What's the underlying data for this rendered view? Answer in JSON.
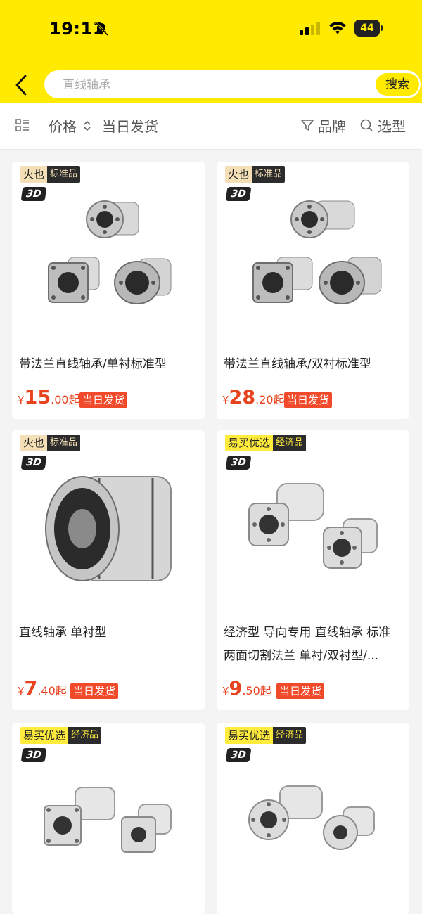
{
  "status_bar": {
    "time": "19:11",
    "battery": "44"
  },
  "search": {
    "placeholder": "直线轴承",
    "button": "搜索"
  },
  "filters": {
    "price": "价格",
    "same_day": "当日发货",
    "brand": "品牌",
    "select": "选型"
  },
  "products": [
    {
      "brand": "火也",
      "type": "标准品",
      "badge": "3D",
      "title": "带法兰直线轴承/单衬标准型",
      "price_big": "15",
      "price_small": ".00起",
      "currency": "¥",
      "ship": "当日发货"
    },
    {
      "brand": "火也",
      "type": "标准品",
      "badge": "3D",
      "title": "带法兰直线轴承/双衬标准型",
      "price_big": "28",
      "price_small": ".20起",
      "currency": "¥",
      "ship": "当日发货"
    },
    {
      "brand": "火也",
      "type": "标准品",
      "badge": "3D",
      "title": "直线轴承 单衬型",
      "price_big": "7",
      "price_small": ".40起",
      "currency": "¥",
      "ship": "当日发货"
    },
    {
      "brand": "易买优选",
      "type": "经济品",
      "badge": "3D",
      "title": "经济型 导向专用 直线轴承 标准两面切割法兰 单衬/双衬型/...",
      "price_big": "9",
      "price_small": ".50起",
      "currency": "¥",
      "ship": "当日发货"
    },
    {
      "brand": "易买优选",
      "type": "经济品",
      "badge": "3D"
    },
    {
      "brand": "易买优选",
      "type": "经济品",
      "badge": "3D"
    }
  ],
  "colors": {
    "header": "#ffea00",
    "price": "#e8431f",
    "ship_badge": "#f04a2a"
  }
}
